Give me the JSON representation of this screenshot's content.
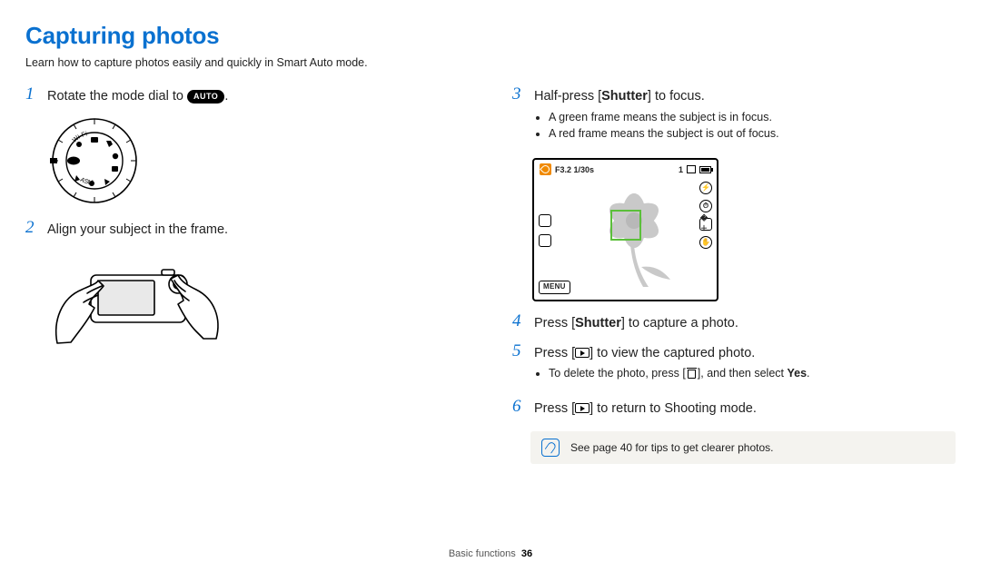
{
  "page": {
    "title": "Capturing photos",
    "subtitle": "Learn how to capture photos easily and quickly in Smart Auto mode.",
    "footer_section": "Basic functions",
    "footer_page": "36"
  },
  "left": {
    "step1_pre": "Rotate the mode dial to ",
    "step1_auto": "AUTO",
    "step1_post": ".",
    "step2": "Align your subject in the frame.",
    "dial_labels": {
      "wifi": "Wi-Fi",
      "asm": "ASM"
    }
  },
  "right": {
    "step3_pre": "Half-press [",
    "step3_bold": "Shutter",
    "step3_post": "] to focus.",
    "step3_b1": "A green frame means the subject is in focus.",
    "step3_b2": "A red frame means the subject is out of focus.",
    "lcd": {
      "exposure": "F3.2 1/30s",
      "count": "1",
      "menu": "MENU"
    },
    "step4_pre": "Press [",
    "step4_bold": "Shutter",
    "step4_post": "] to capture a photo.",
    "step5_pre": "Press [",
    "step5_post": "] to view the captured photo.",
    "step5_b1_pre": "To delete the photo, press [",
    "step5_b1_mid": "], and then select ",
    "step5_b1_yes": "Yes",
    "step5_b1_end": ".",
    "step6_pre": "Press [",
    "step6_post": "] to return to Shooting mode.",
    "tip": "See page 40 for tips to get clearer photos."
  },
  "nums": {
    "n1": "1",
    "n2": "2",
    "n3": "3",
    "n4": "4",
    "n5": "5",
    "n6": "6"
  }
}
